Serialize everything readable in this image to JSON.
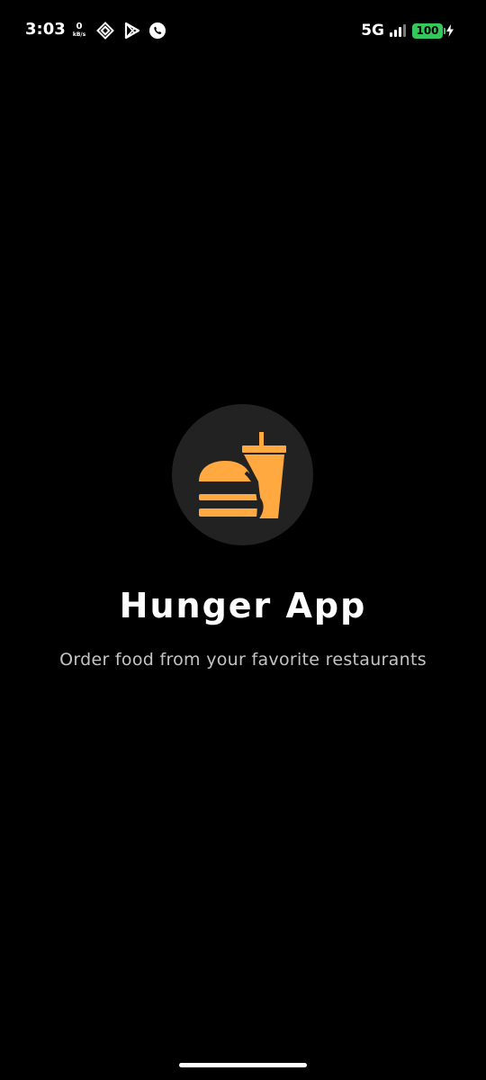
{
  "status_bar": {
    "time": "3:03",
    "net_speed_value": "0",
    "net_speed_unit": "kB/s",
    "network_type": "5G",
    "battery_level": "100",
    "signal_bars_active": 3,
    "signal_bars_total": 4,
    "icons": [
      "data-speed-icon",
      "app-notification-icon",
      "play-store-icon",
      "whatsapp-icon",
      "signal-icon",
      "battery-icon",
      "charging-icon"
    ]
  },
  "splash": {
    "logo_icon": "burger-and-drink-icon",
    "app_title": "Hunger App",
    "tagline": "Order food from your favorite restaurants"
  },
  "colors": {
    "background": "#000000",
    "logo_circle": "#222222",
    "accent": "#FFA940",
    "battery": "#34C759",
    "tagline": "#C4C4C4"
  }
}
